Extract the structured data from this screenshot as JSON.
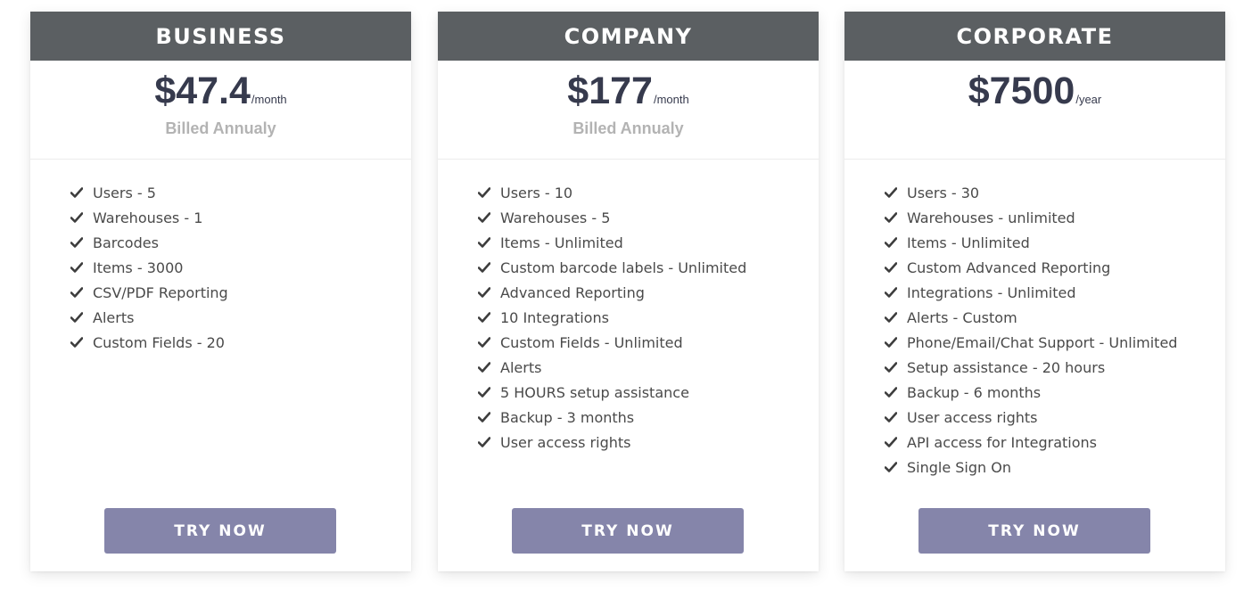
{
  "plans": [
    {
      "name": "BUSINESS",
      "price": "$47.4",
      "period": "/month",
      "billing": "Billed Annualy",
      "features": [
        "Users - 5",
        "Warehouses - 1",
        "Barcodes",
        "Items - 3000",
        "CSV/PDF Reporting",
        "Alerts",
        "Custom Fields - 20"
      ],
      "cta": "TRY NOW"
    },
    {
      "name": "COMPANY",
      "price": "$177",
      "period": "/month",
      "billing": "Billed Annualy",
      "features": [
        "Users - 10",
        "Warehouses - 5",
        "Items - Unlimited",
        "Custom barcode labels - Unlimited",
        "Advanced Reporting",
        "10 Integrations",
        "Custom Fields - Unlimited",
        "Alerts",
        "5 HOURS setup assistance",
        "Backup - 3 months",
        "User access rights"
      ],
      "cta": "TRY NOW"
    },
    {
      "name": "CORPORATE",
      "price": "$7500",
      "period": "/year",
      "billing": "",
      "features": [
        "Users - 30",
        "Warehouses - unlimited",
        "Items - Unlimited",
        "Custom Advanced Reporting",
        "Integrations - Unlimited",
        "Alerts - Custom",
        "Phone/Email/Chat Support - Unlimited",
        "Setup assistance - 20 hours",
        "Backup - 6 months",
        "User access rights",
        "API access for Integrations",
        "Single Sign On"
      ],
      "cta": "TRY NOW"
    }
  ],
  "icons": {
    "feature_bullet": "check-icon"
  },
  "colors": {
    "header_bg": "#5b5f62",
    "price_text": "#363a4d",
    "billing_text": "#b3b3b3",
    "button_bg": "#8585aa"
  }
}
